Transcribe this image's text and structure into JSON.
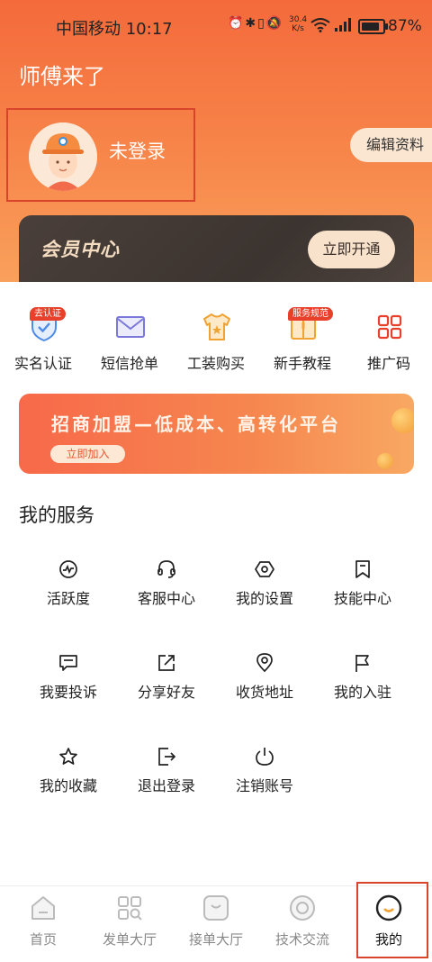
{
  "status_bar": {
    "carrier_time": "中国移动 10:17",
    "net_speed_value": "30.4",
    "net_speed_unit": "K/s",
    "battery": "87%"
  },
  "header": {
    "app_title": "师傅来了",
    "username": "未登录",
    "edit_profile": "编辑资料"
  },
  "vip": {
    "title": "会员中心",
    "button": "立即开通"
  },
  "quick_actions": [
    {
      "label": "实名认证",
      "tag": "去认证",
      "icon": "shield-check-icon"
    },
    {
      "label": "短信抢单",
      "tag": "",
      "icon": "envelope-icon"
    },
    {
      "label": "工装购买",
      "tag": "",
      "icon": "tshirt-icon"
    },
    {
      "label": "新手教程",
      "tag": "服务规范",
      "icon": "book-icon"
    },
    {
      "label": "推广码",
      "tag": "",
      "icon": "qrcode-icon"
    }
  ],
  "banner": {
    "title": "招商加盟—低成本、高转化平台",
    "button": "立即加入"
  },
  "services": {
    "title": "我的服务",
    "items": [
      {
        "label": "活跃度",
        "icon": "activity-icon"
      },
      {
        "label": "客服中心",
        "icon": "headset-icon"
      },
      {
        "label": "我的设置",
        "icon": "settings-hex-icon"
      },
      {
        "label": "技能中心",
        "icon": "bookmark-icon"
      },
      {
        "label": "我要投诉",
        "icon": "complaint-icon"
      },
      {
        "label": "分享好友",
        "icon": "share-icon"
      },
      {
        "label": "收货地址",
        "icon": "location-icon"
      },
      {
        "label": "我的入驻",
        "icon": "flag-icon"
      },
      {
        "label": "我的收藏",
        "icon": "star-icon"
      },
      {
        "label": "退出登录",
        "icon": "logout-icon"
      },
      {
        "label": "注销账号",
        "icon": "power-icon"
      }
    ]
  },
  "tabbar": {
    "active": "我的",
    "items": [
      {
        "label": "首页",
        "icon": "home-icon"
      },
      {
        "label": "发单大厅",
        "icon": "grid-search-icon"
      },
      {
        "label": "接单大厅",
        "icon": "inbox-icon"
      },
      {
        "label": "技术交流",
        "icon": "target-icon"
      },
      {
        "label": "我的",
        "icon": "smile-icon"
      }
    ]
  },
  "colors": {
    "header_orange": "#f46a3b",
    "accent_red": "#e8402a",
    "vip_dark": "#3c3430",
    "vip_gold": "#f4dcc0"
  }
}
